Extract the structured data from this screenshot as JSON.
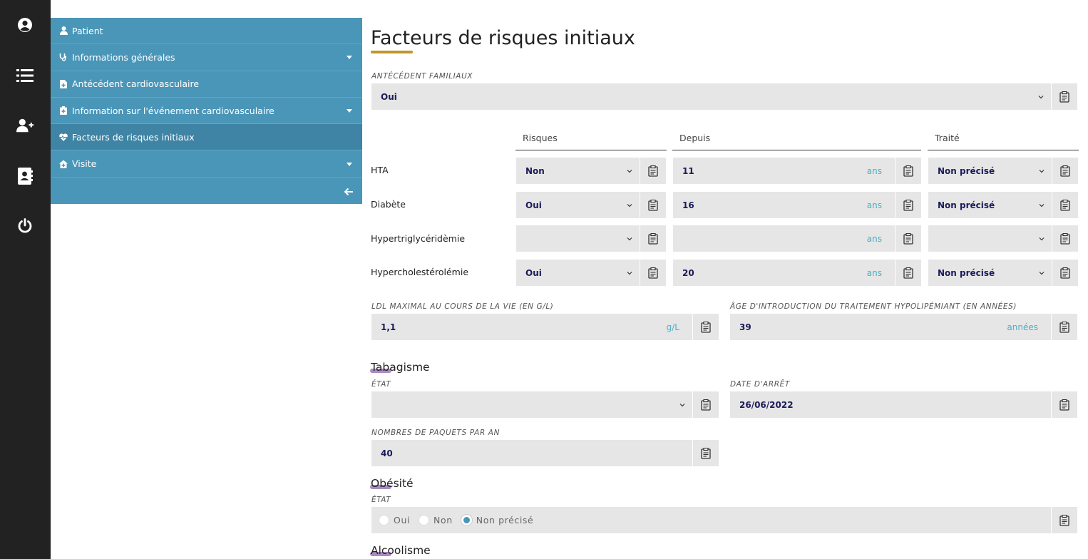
{
  "rail": {
    "icons": [
      "user-circle-icon",
      "list-icon",
      "user-plus-icon",
      "address-book-icon",
      "power-icon"
    ]
  },
  "menu": {
    "items": [
      {
        "label": "Patient",
        "icon": "user-icon",
        "caret": false
      },
      {
        "label": "Informations générales",
        "icon": "stethoscope-icon",
        "caret": true
      },
      {
        "label": "Antécédent cardiovasculaire",
        "icon": "file-medical-icon",
        "caret": false
      },
      {
        "label": "Information sur l'événement cardiovasculaire",
        "icon": "notes-medical-icon",
        "caret": true
      },
      {
        "label": "Facteurs de risques initiaux",
        "icon": "heartbeat-icon",
        "caret": false
      },
      {
        "label": "Visite",
        "icon": "house-medical-icon",
        "caret": true
      }
    ]
  },
  "page": {
    "title": "Facteurs de risques initiaux"
  },
  "famille": {
    "label": "Antécédent familiaux",
    "value": "Oui"
  },
  "table": {
    "headers": [
      "Risques",
      "Depuis",
      "Traité"
    ],
    "unit": "ans",
    "rows": [
      {
        "label": "HTA",
        "risque": "Non",
        "depuis": "11",
        "traite": "Non précisé"
      },
      {
        "label": "Diabète",
        "risque": "Oui",
        "depuis": "16",
        "traite": "Non précisé"
      },
      {
        "label": "Hypertriglycéridèmie",
        "risque": "",
        "depuis": "",
        "traite": ""
      },
      {
        "label": "Hypercholestérolémie",
        "risque": "Oui",
        "depuis": "20",
        "traite": "Non précisé"
      }
    ]
  },
  "ldl": {
    "label": "LDL maximal au cours de la vie (en g/L)",
    "value": "1,1",
    "unit": "g/L"
  },
  "age_intro": {
    "label": "Âge d'introduction du traitement hypolipémiant (en années)",
    "value": "39",
    "unit": "années"
  },
  "tabagisme": {
    "title": "Tabagisme",
    "etat_label": "État",
    "etat_value": "",
    "date_label": "Date d'arrêt",
    "date_value": "26/06/2022",
    "paquets_label": "Nombres de paquets par an",
    "paquets_value": "40"
  },
  "obesite": {
    "title": "Obésité",
    "etat_label": "État",
    "options": [
      "Oui",
      "Non",
      "Non précisé"
    ],
    "selected": "Non précisé"
  },
  "alcoolisme": {
    "title": "Alcoolisme"
  },
  "colors": {
    "rail": "#222222",
    "menu": "#4a96b8",
    "menu_active": "#3f84a4",
    "title_accent": "#c0962c",
    "section_accent": "#9a76b8",
    "value_text": "#1b1b5a",
    "unit_text": "#4ab0c6"
  }
}
